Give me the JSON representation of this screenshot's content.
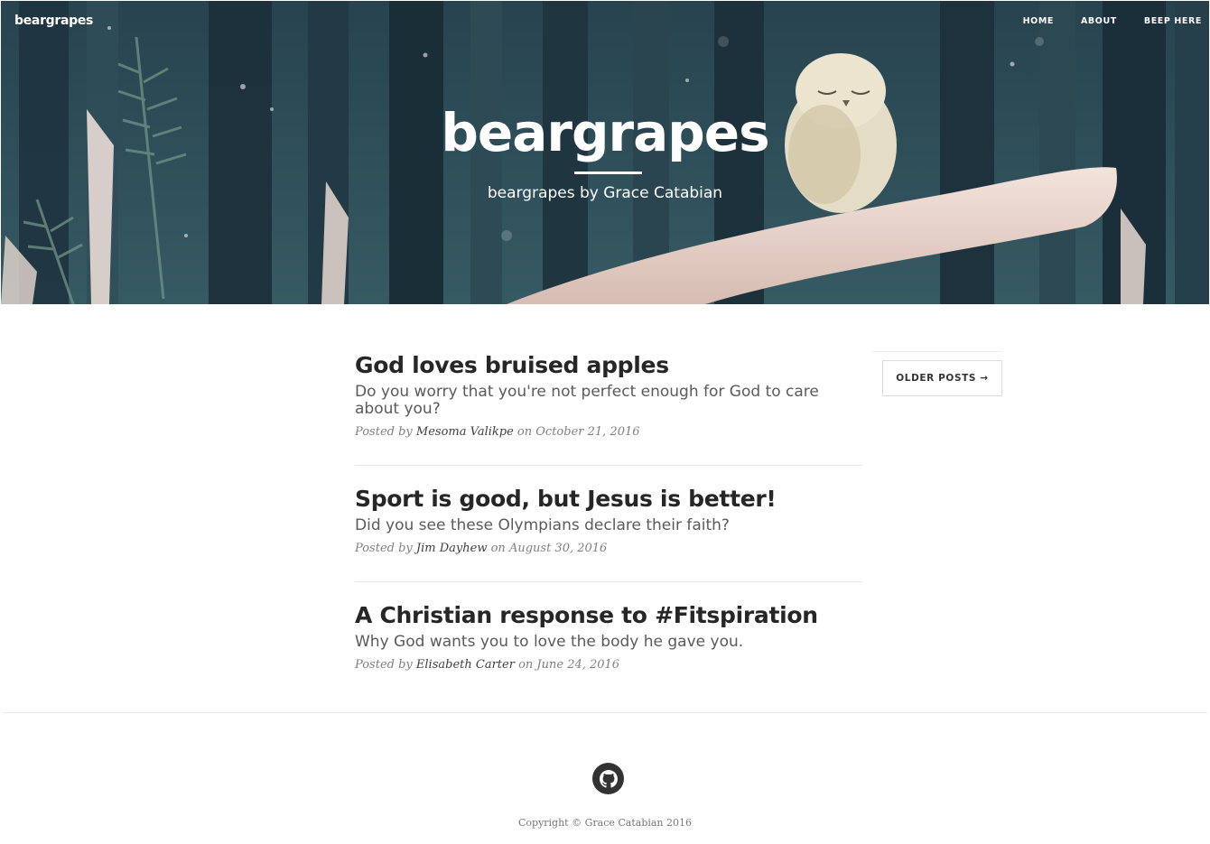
{
  "navbar": {
    "brand": "beargrapes",
    "links": [
      "HOME",
      "ABOUT",
      "BEEP HERE"
    ]
  },
  "hero": {
    "title": "beargrapes",
    "subtitle": "beargrapes by Grace Catabian"
  },
  "posts": [
    {
      "title": "God loves bruised apples",
      "subtitle": "Do you worry that you're not perfect enough for God to care about you?",
      "posted_by": "Posted by",
      "author": "Mesoma Valikpe",
      "on": "on",
      "date": "October 21, 2016"
    },
    {
      "title": "Sport is good, but Jesus is better!",
      "subtitle": "Did you see these Olympians declare their faith?",
      "posted_by": "Posted by",
      "author": "Jim Dayhew",
      "on": "on",
      "date": "August 30, 2016"
    },
    {
      "title": "A Christian response to #Fitspiration",
      "subtitle": "Why God wants you to love the body he gave you.",
      "posted_by": "Posted by",
      "author": "Elisabeth Carter",
      "on": "on",
      "date": "June 24, 2016"
    }
  ],
  "pager": {
    "older_label": "OLDER POSTS →"
  },
  "footer": {
    "icon": "github-icon",
    "copyright": "Copyright © Grace Catabian 2016"
  },
  "colors": {
    "hero_bg": "#2c4a55",
    "text_dark": "#262626",
    "text_muted": "#808080"
  }
}
